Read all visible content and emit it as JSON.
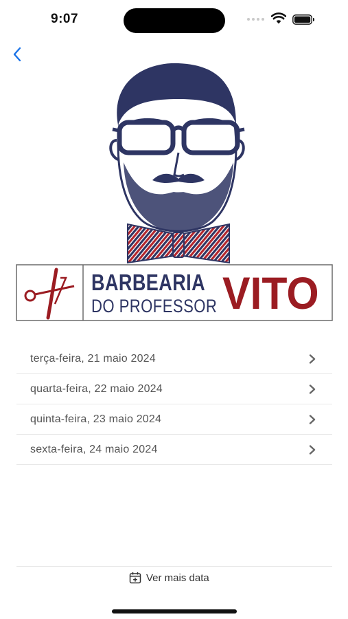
{
  "status_bar": {
    "time": "9:07"
  },
  "logo": {
    "line1": "BARBEARIA",
    "line2": "DO PROFESSOR",
    "name": "VITO",
    "navy": "#2e3563",
    "red": "#9b1c22"
  },
  "dates": [
    {
      "label": "terça-feira, 21 maio 2024"
    },
    {
      "label": "quarta-feira, 22 maio 2024"
    },
    {
      "label": "quinta-feira, 23 maio 2024"
    },
    {
      "label": "sexta-feira, 24 maio 2024"
    }
  ],
  "footer": {
    "more_dates_label": "Ver mais data",
    "icon": "calendar-plus-icon"
  },
  "colors": {
    "accent": "#1a73e8",
    "chevron": "#666666"
  }
}
